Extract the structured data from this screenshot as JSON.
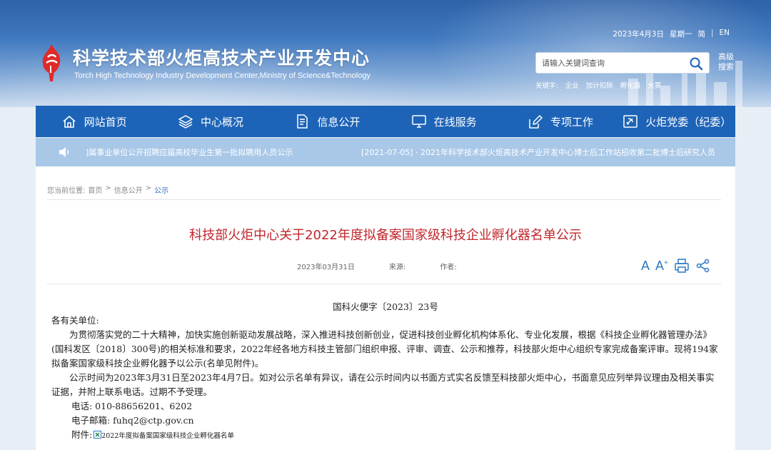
{
  "header": {
    "title_cn": "科学技术部火炬高技术产业开发中心",
    "title_en": "Torch High Technology Industry Development Center,Ministry of Science&Technology",
    "date": "2023年4月3日",
    "weekday": "星期一",
    "lang_simplified": "简",
    "lang_sep": "|",
    "lang_en": "EN",
    "search_placeholder": "请输入关键词查询",
    "advanced_search": "高级搜索",
    "hot_label": "关键字:",
    "hot_keywords": [
      "企业",
      "加计扣除",
      "孵化器",
      "大赛"
    ]
  },
  "nav": [
    {
      "label": "网站首页",
      "icon": "home-icon"
    },
    {
      "label": "中心概况",
      "icon": "layers-icon"
    },
    {
      "label": "信息公开",
      "icon": "document-icon"
    },
    {
      "label": "在线服务",
      "icon": "monitor-icon"
    },
    {
      "label": "专项工作",
      "icon": "edit-icon"
    },
    {
      "label": "火炬党委（纪委）",
      "icon": "party-icon"
    }
  ],
  "notice": {
    "item1": "]属事业单位公开招聘应届高校毕业生第一批拟聘用人员公示",
    "item2": "[2021-07-05] · 2021年科学技术部火炬高技术产业开发中心博士后工作站招收第二批博士后研究人员"
  },
  "breadcrumb": {
    "prefix": "您当前位置:",
    "items": [
      "首页",
      "信息公开",
      "公示"
    ],
    "sep": ">"
  },
  "article": {
    "title": "科技部火炬中心关于2022年度拟备案国家级科技企业孵化器名单公示",
    "date": "2023年03月31日",
    "source_label": "来源:",
    "author_label": "作者:",
    "font_decrease": "A",
    "font_increase": "A",
    "font_increase_sup": "+",
    "doc_number": "国科火便字〔2023〕23号",
    "salutation": "各有关单位:",
    "para1": "为贯彻落实党的二十大精神，加快实施创新驱动发展战略，深入推进科技创新创业，促进科技创业孵化机构体系化、专业化发展，根据《科技企业孵化器管理办法》(国科发区〔2018〕300号)的相关标准和要求，2022年经各地方科技主管部门组织申报、评审、调查、公示和推荐，科技部火炬中心组织专家完成备案评审。现将194家拟备案国家级科技企业孵化器予以公示(名单见附件)。",
    "para2": "公示时间为2023年3月31日至2023年4月7日。如对公示名单有异议，请在公示时间内以书面方式实名反馈至科技部火炬中心，书面意见应列举异议理由及相关事实证据，并附上联系电话。过期不予受理。",
    "phone": "电话: 010-88656201、6202",
    "email": "电子邮箱: fuhq2@ctp.gov.cn",
    "attachment_label": "附件:",
    "attachment_link": "2022年度拟备案国家级科技企业孵化器名单"
  }
}
